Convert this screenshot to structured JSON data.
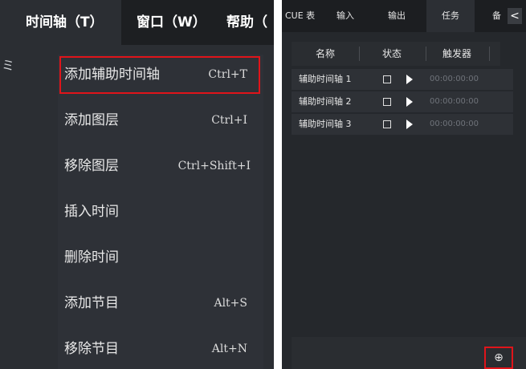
{
  "menubar": {
    "timeline": "时间轴（T）",
    "window": "窗口（W）",
    "help": "帮助（"
  },
  "left_edge_glyph": "ミ",
  "menu_items": [
    {
      "label": "添加辅助时间轴",
      "shortcut": "Ctrl+T"
    },
    {
      "label": "添加图层",
      "shortcut": "Ctrl+I"
    },
    {
      "label": "移除图层",
      "shortcut": "Ctrl+Shift+I"
    },
    {
      "label": "插入时间",
      "shortcut": ""
    },
    {
      "label": "删除时间",
      "shortcut": ""
    },
    {
      "label": "添加节目",
      "shortcut": "Alt+S"
    },
    {
      "label": "移除节目",
      "shortcut": "Alt+N"
    }
  ],
  "tabs": [
    {
      "label": "CUE 表"
    },
    {
      "label": "输入"
    },
    {
      "label": "输出"
    },
    {
      "label": "任务",
      "active": true
    },
    {
      "label": "备"
    }
  ],
  "collapse_glyph": "<",
  "table": {
    "headers": [
      "名称",
      "状态",
      "触发器"
    ],
    "rows": [
      {
        "name": "辅助时间轴 1",
        "trigger": "00:00:00:00"
      },
      {
        "name": "辅助时间轴 2",
        "trigger": "00:00:00:00"
      },
      {
        "name": "辅助时间轴 3",
        "trigger": "00:00:00:00"
      }
    ]
  },
  "add_button": "⊕",
  "colors": {
    "menu_bg": "#2b2e33",
    "menubar_bg": "#1d1f22",
    "panel_bg": "#25282c",
    "highlight_border": "#e0141a",
    "trigger_text": "#6f737a"
  }
}
